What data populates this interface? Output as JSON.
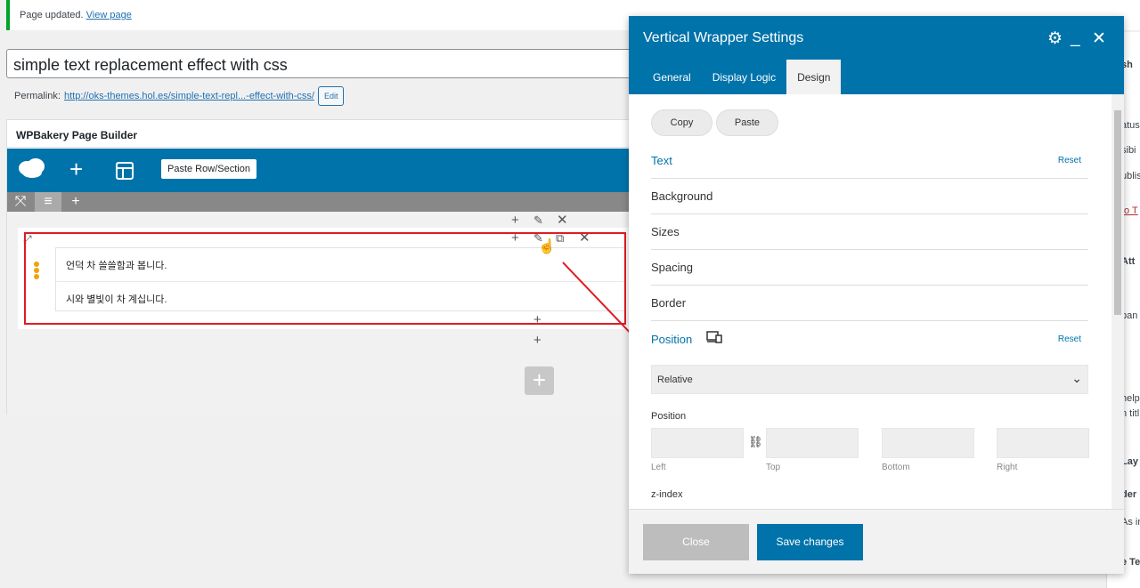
{
  "notice": {
    "text": "Page updated.",
    "link": "View page"
  },
  "post_title": "simple text replacement effect with css",
  "permalink": {
    "label": "Permalink:",
    "url": "http://oks-themes.hol.es/simple-text-repl...-effect-with-css/",
    "edit": "Edit"
  },
  "builder": {
    "title": "WPBakery Page Builder",
    "paste_row": "Paste Row/Section",
    "text_lines": [
      "언덕 차 쓸쓸함과 봅니다.",
      "시와 별빛이 차 계십니다."
    ]
  },
  "right_strip": [
    "sh",
    "atus",
    "sibi",
    "ublis",
    "to T",
    "Att",
    "t",
    "pan",
    "help",
    "n titl",
    "Lay",
    "der",
    "As in",
    "e Te"
  ],
  "modal": {
    "title": "Vertical Wrapper Settings",
    "tabs": [
      "General",
      "Display Logic",
      "Design"
    ],
    "active_tab": "Design",
    "copy": "Copy",
    "paste": "Paste",
    "sections": {
      "text": "Text",
      "background": "Background",
      "sizes": "Sizes",
      "spacing": "Spacing",
      "border": "Border",
      "position": "Position"
    },
    "reset": "Reset",
    "position_select": "Relative",
    "position_label": "Position",
    "inputs": {
      "left": "Left",
      "top": "Top",
      "bottom": "Bottom",
      "right": "Right"
    },
    "zindex_label": "z-index",
    "close": "Close",
    "save": "Save changes"
  },
  "colors": {
    "accent": "#0073aa",
    "annotation": "#e01b24"
  }
}
